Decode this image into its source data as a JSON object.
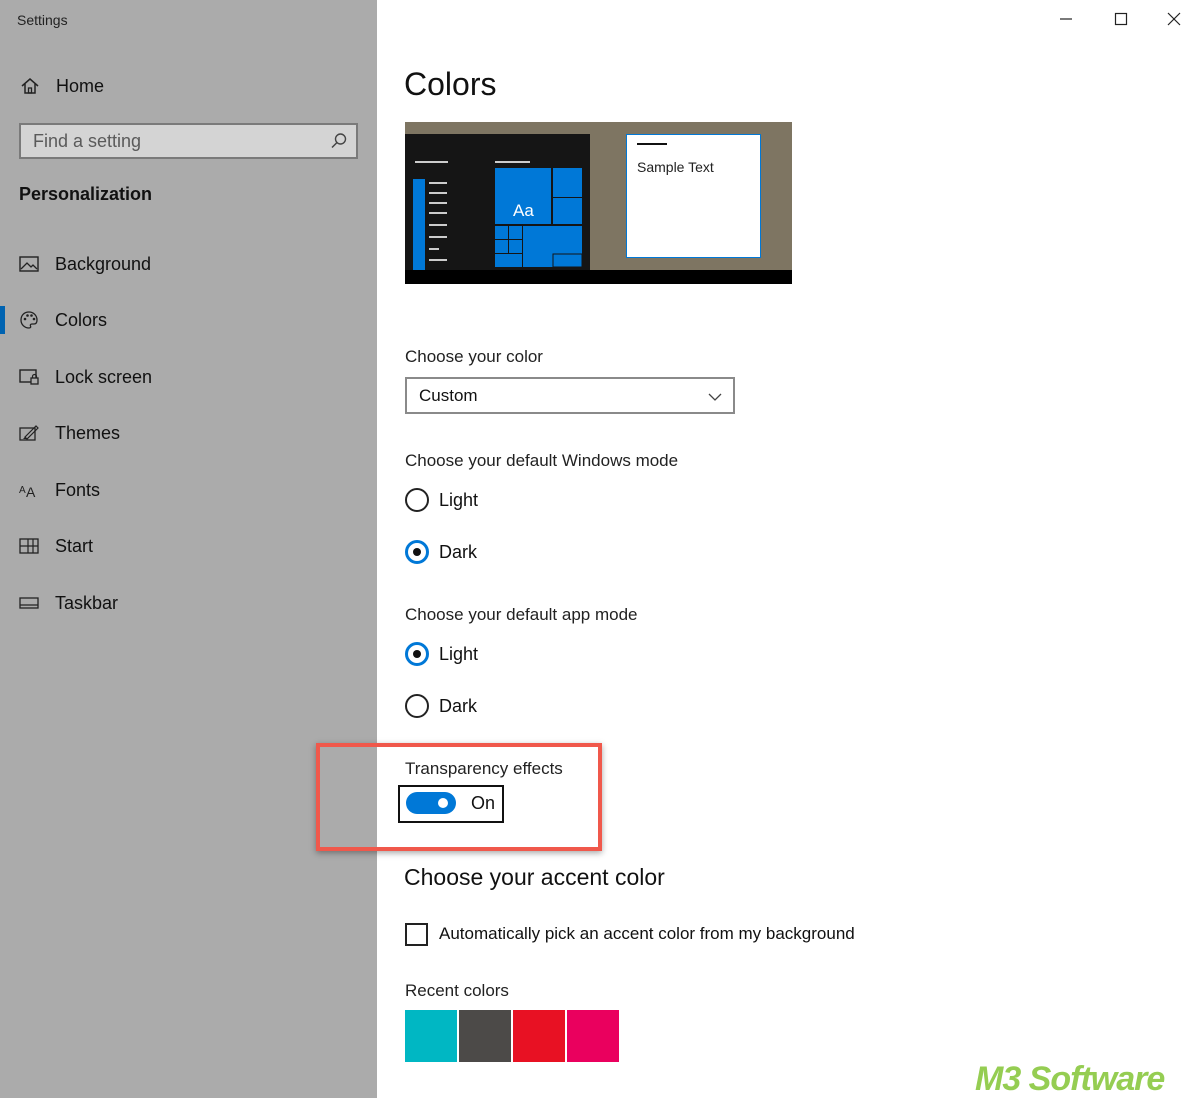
{
  "window": {
    "title": "Settings"
  },
  "sidebar": {
    "home_label": "Home",
    "search_placeholder": "Find a setting",
    "section_label": "Personalization",
    "items": [
      {
        "label": "Background",
        "icon": "picture-icon"
      },
      {
        "label": "Colors",
        "icon": "palette-icon",
        "active": true
      },
      {
        "label": "Lock screen",
        "icon": "lock-screen-icon"
      },
      {
        "label": "Themes",
        "icon": "themes-brush-icon"
      },
      {
        "label": "Fonts",
        "icon": "fonts-icon",
        "glyph": "AA"
      },
      {
        "label": "Start",
        "icon": "start-grid-icon"
      },
      {
        "label": "Taskbar",
        "icon": "taskbar-icon"
      }
    ],
    "active_indicator_color": "#0063b1"
  },
  "main": {
    "title": "Colors",
    "preview": {
      "tile_label": "Aa",
      "sample_text": "Sample Text",
      "accent_color": "#0078d7"
    },
    "choose_color": {
      "label": "Choose your color",
      "value": "Custom"
    },
    "windows_mode": {
      "label": "Choose your default Windows mode",
      "options": [
        {
          "label": "Light",
          "checked": false
        },
        {
          "label": "Dark",
          "checked": true
        }
      ]
    },
    "app_mode": {
      "label": "Choose your default app mode",
      "options": [
        {
          "label": "Light",
          "checked": true
        },
        {
          "label": "Dark",
          "checked": false
        }
      ]
    },
    "transparency": {
      "label": "Transparency effects",
      "state": "On",
      "highlight_color": "#f0584b"
    },
    "accent": {
      "heading": "Choose your accent color",
      "auto_pick_label": "Automatically pick an accent color from my background",
      "auto_pick_checked": false,
      "recent_label": "Recent colors",
      "recent_colors": [
        "#00b7c3",
        "#4c4a48",
        "#e81123",
        "#ea005e"
      ]
    }
  },
  "watermark": "M3 Software"
}
